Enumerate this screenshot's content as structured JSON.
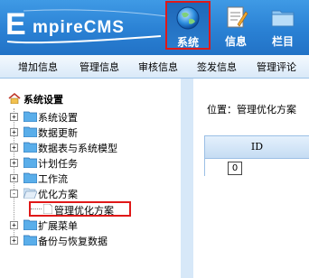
{
  "logo": {
    "letter": "E",
    "rest": "mpireCMS"
  },
  "top_buttons": [
    {
      "label": "系统",
      "icon": "globe-icon"
    },
    {
      "label": "信息",
      "icon": "document-icon"
    },
    {
      "label": "栏目",
      "icon": "folder-icon"
    }
  ],
  "menu": [
    "增加信息",
    "管理信息",
    "审核信息",
    "签发信息",
    "管理评论"
  ],
  "tree": {
    "title": "系统设置",
    "items": [
      {
        "label": "系统设置",
        "expander": "+"
      },
      {
        "label": "数据更新",
        "expander": "+"
      },
      {
        "label": "数据表与系统模型",
        "expander": "+"
      },
      {
        "label": "计划任务",
        "expander": "+"
      },
      {
        "label": "工作流",
        "expander": "+"
      },
      {
        "label": "优化方案",
        "expander": "-"
      },
      {
        "label": "扩展菜单",
        "expander": "+"
      },
      {
        "label": "备份与恢复数据",
        "expander": "+"
      }
    ],
    "subitem": "管理优化方案"
  },
  "main": {
    "location": "位置：管理优化方案",
    "table_header": "ID",
    "row_id": "0"
  },
  "colors": {
    "header_blue": "#2a81d4",
    "highlight_red": "#e01818",
    "folder_yellow": "#f5c440"
  }
}
